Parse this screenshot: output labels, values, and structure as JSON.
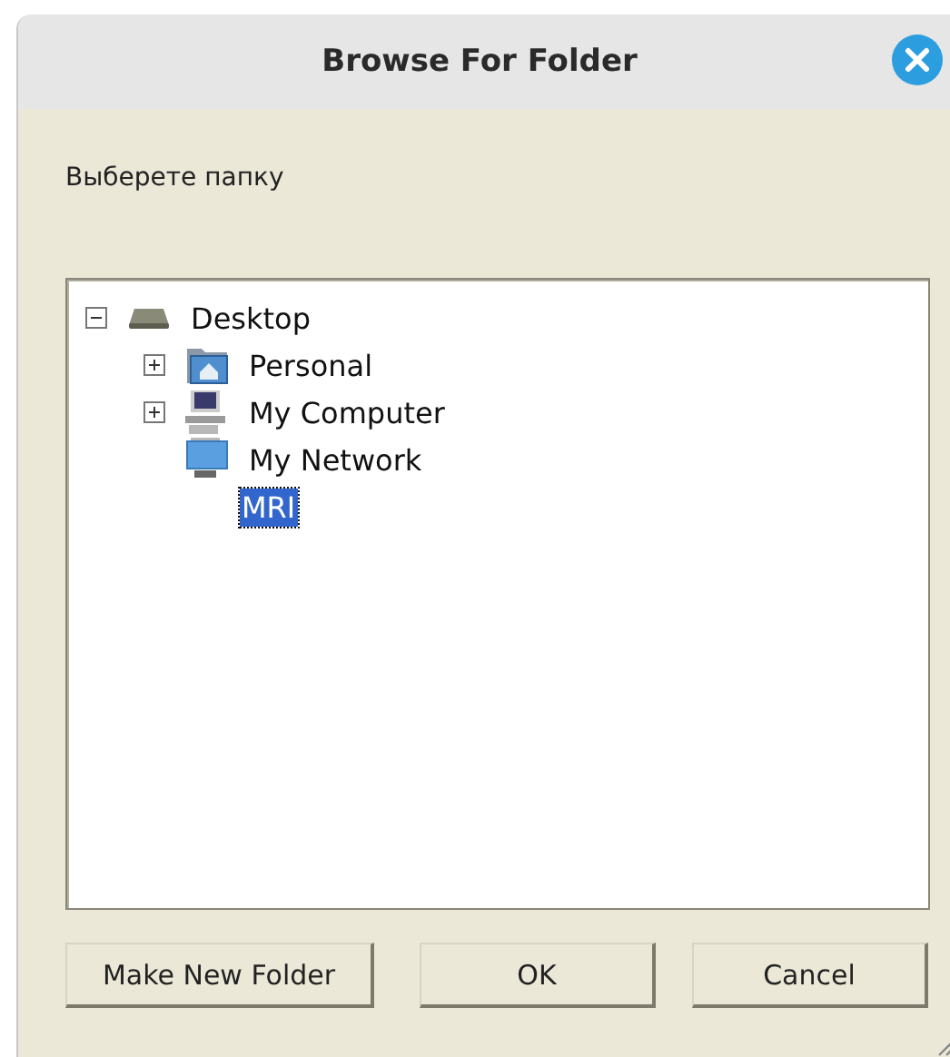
{
  "window": {
    "title": "Browse For Folder"
  },
  "prompt": "Выберете папку",
  "tree": [
    {
      "label": "Desktop",
      "kind": "drive",
      "expandable": true,
      "expanded": true,
      "selected": false,
      "children": [
        {
          "label": "Personal",
          "kind": "home-folder",
          "expandable": true,
          "expanded": false,
          "selected": false
        },
        {
          "label": "My Computer",
          "kind": "computer",
          "expandable": true,
          "expanded": false,
          "selected": false
        },
        {
          "label": "My Network",
          "kind": "network",
          "selected": false,
          "children": [
            {
              "label": "MRI",
              "kind": "none",
              "selected": true
            }
          ]
        }
      ]
    }
  ],
  "buttons": [
    "Make New Folder",
    "OK",
    "Cancel"
  ]
}
